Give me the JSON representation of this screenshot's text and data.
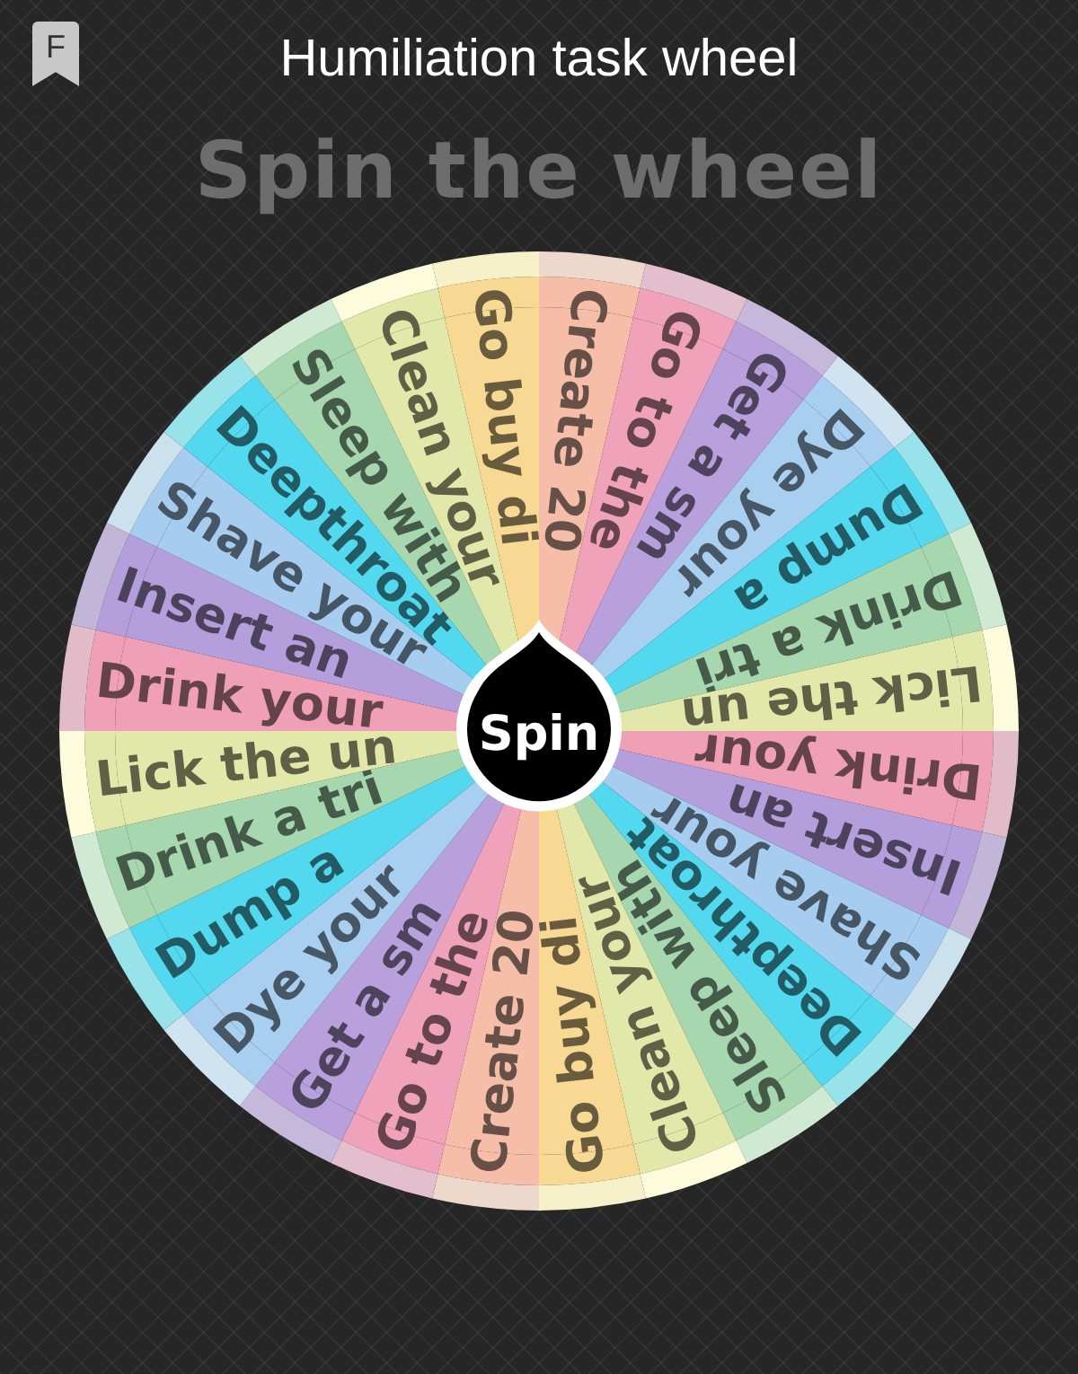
{
  "badge": "F",
  "title": "Humiliation task wheel",
  "heading": "Spin the wheel",
  "spin_button": "Spin",
  "segments": [
    {
      "label": "Create 20",
      "color": "#f6bea8"
    },
    {
      "label": "Go to the",
      "color": "#f0a2bb"
    },
    {
      "label": "Get a sm",
      "color": "#b7a0dc"
    },
    {
      "label": "Dye your",
      "color": "#a9cff0"
    },
    {
      "label": "Dump a",
      "color": "#52d9ef"
    },
    {
      "label": "Drink a tri",
      "color": "#a7d7ae"
    },
    {
      "label": "Lick the un",
      "color": "#e2e8aa"
    },
    {
      "label": "Drink your",
      "color": "#ef9fb6"
    },
    {
      "label": "Insert an",
      "color": "#b49edb"
    },
    {
      "label": "Shave your",
      "color": "#a6ccef"
    },
    {
      "label": "Deepthroat",
      "color": "#52d9ef"
    },
    {
      "label": "Sleep with",
      "color": "#a7d7ae"
    },
    {
      "label": "Clean your",
      "color": "#e2e8aa"
    },
    {
      "label": "Go buy di",
      "color": "#f7d993"
    },
    {
      "label": "Create 20",
      "color": "#f6bea8"
    },
    {
      "label": "Go to the",
      "color": "#f0a2bb"
    },
    {
      "label": "Get a sm",
      "color": "#b7a0dc"
    },
    {
      "label": "Dye your",
      "color": "#a9cff0"
    },
    {
      "label": "Dump a",
      "color": "#52d9ef"
    },
    {
      "label": "Drink a tri",
      "color": "#a7d7ae"
    },
    {
      "label": "Lick the un",
      "color": "#e2e8aa"
    },
    {
      "label": "Drink your",
      "color": "#ef9fb6"
    },
    {
      "label": "Insert an",
      "color": "#b49edb"
    },
    {
      "label": "Shave your",
      "color": "#a6ccef"
    },
    {
      "label": "Deepthroat",
      "color": "#52d9ef"
    },
    {
      "label": "Sleep with",
      "color": "#a7d7ae"
    },
    {
      "label": "Clean your",
      "color": "#e2e8aa"
    },
    {
      "label": "Go buy di",
      "color": "#f7d993"
    }
  ]
}
